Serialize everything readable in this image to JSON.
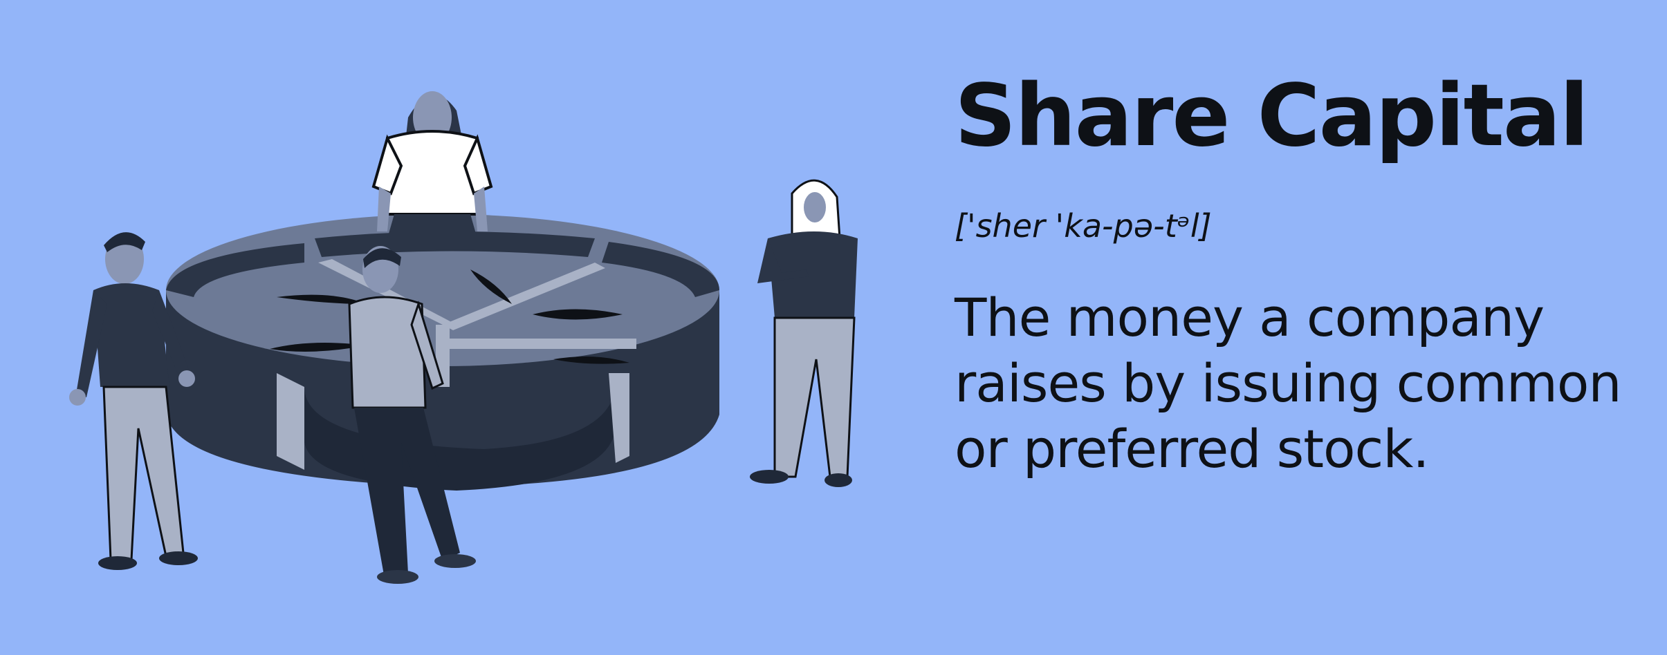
{
  "term": {
    "title": "Share Capital",
    "pronunciation": "['sher 'ka-pə-tᵊl]",
    "definition": "The money a company raises by issuing common or preferred stock."
  },
  "illustration": {
    "subject": "people-around-pie-chart",
    "colors": {
      "background": "#93b5f9",
      "dark": "#2b3547",
      "mid": "#6d7a96",
      "light": "#a9b2c6",
      "skin": "#8a96b4",
      "white": "#ffffff"
    }
  }
}
